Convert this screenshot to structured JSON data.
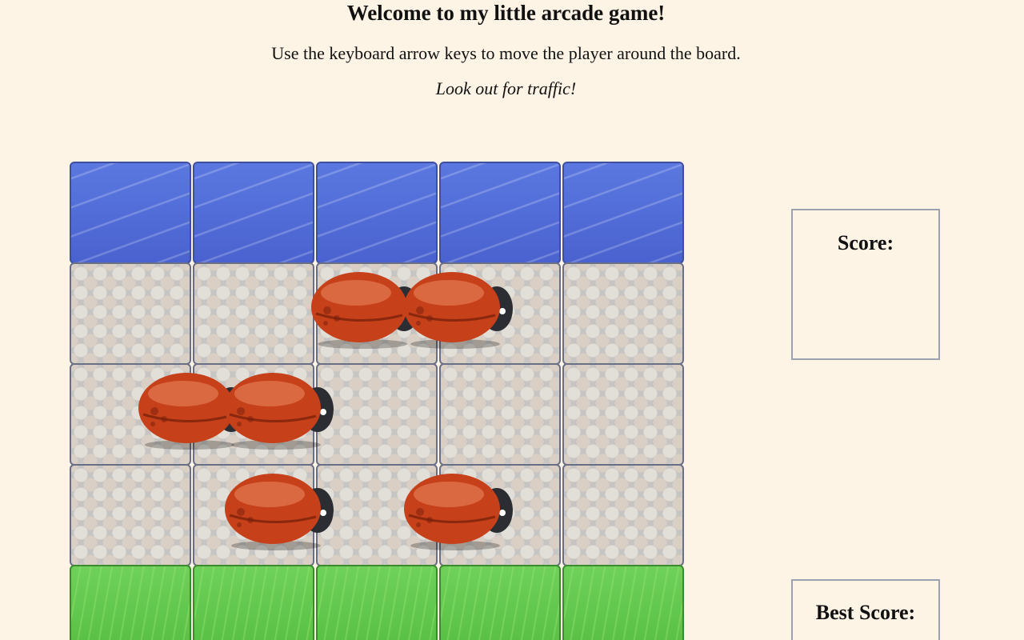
{
  "header": {
    "title": "Welcome to my little arcade game!",
    "instructions": "Use the keyboard arrow keys to move the player around the board.",
    "warning": "Look out for traffic!"
  },
  "board": {
    "columns": 5,
    "rows": [
      "water",
      "stone",
      "stone",
      "stone",
      "grass"
    ],
    "enemies": [
      {
        "row": 1,
        "col": 2.0
      },
      {
        "row": 1,
        "col": 2.75
      },
      {
        "row": 2,
        "col": 0.6
      },
      {
        "row": 2,
        "col": 1.3
      },
      {
        "row": 3,
        "col": 1.3
      },
      {
        "row": 3,
        "col": 2.75
      }
    ]
  },
  "scoreboard": {
    "score_label": "Score:",
    "score_value": "",
    "best_label": "Best Score:",
    "best_value": ""
  },
  "colors": {
    "background": "#fdf4e5",
    "bug_shell": "#c6401a",
    "water": "#4f6ad6",
    "grass": "#5cc447"
  }
}
